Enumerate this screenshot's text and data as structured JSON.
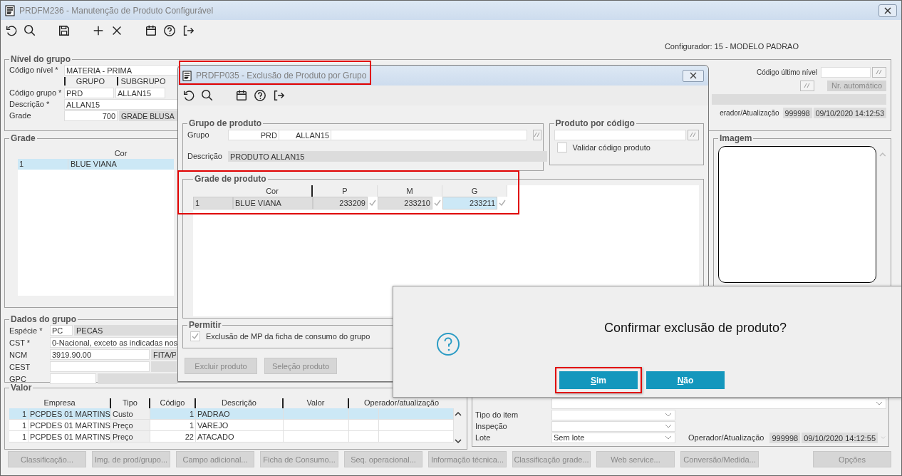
{
  "window": {
    "title": "PRDFM236 - Manutenção de Produto Configurável"
  },
  "configurador": "Configurador: 15 - MODELO PADRAO",
  "nivel_do_grupo": {
    "title": "Nível do grupo",
    "codigo_nivel": {
      "label": "Código nível *",
      "value": "MATERIA - PRIMA"
    },
    "columns": [
      "GRUPO",
      "SUBGRUPO"
    ],
    "codigo_grupo": {
      "label": "Código grupo *",
      "values": [
        "PRD",
        "ALLAN15"
      ]
    },
    "descricao": {
      "label": "Descrição *",
      "value": "ALLAN15"
    },
    "grade": {
      "label": "Grade",
      "value": "700",
      "description": "GRADE BLUSA"
    },
    "codigo_ultimo_nivel": {
      "label": "Código último nível"
    },
    "nr_automatico": "Nr. automático",
    "operador": {
      "label": "erador/Atualização",
      "values": [
        "999998",
        "09/10/2020 14:12:53"
      ]
    }
  },
  "grade": {
    "title": "Grade",
    "columns": [
      "",
      "Cor"
    ],
    "rows": [
      {
        "cells": [
          "1",
          "BLUE VIANA"
        ],
        "selected": true
      }
    ]
  },
  "imagem": {
    "title": "Imagem"
  },
  "dados_do_grupo": {
    "title": "Dados do grupo",
    "especie": {
      "label": "Espécie *",
      "value": "PC",
      "description": "PECAS"
    },
    "cst": {
      "label": "CST *",
      "value": "0-Nacional, exceto as indicadas nos"
    },
    "ncm": {
      "label": "NCM",
      "value": "3919.90.00",
      "description": "FITA/P"
    },
    "cest": {
      "label": "CEST"
    },
    "gpc": {
      "label": "GPC"
    }
  },
  "valor": {
    "title": "Valor",
    "columns": [
      "Empresa",
      "Tipo",
      "Código",
      "Descrição",
      "Valor",
      "Operador/atualização"
    ],
    "rows": [
      {
        "empresa": "1",
        "nome": "PCPDES 01 MARTINS",
        "tipo": "Custo",
        "codigo": "1",
        "descricao": "PADRAO",
        "selected": true
      },
      {
        "empresa": "1",
        "nome": "PCPDES 01 MARTINS",
        "tipo": "Preço",
        "codigo": "1",
        "descricao": "VAREJO",
        "selected": false
      },
      {
        "empresa": "1",
        "nome": "PCPDES 01 MARTINS",
        "tipo": "Preço",
        "codigo": "22",
        "descricao": "ATACADO",
        "selected": false
      }
    ]
  },
  "item_panel": {
    "fields": [
      {
        "kind": "wide"
      },
      {
        "label": "Tipo do item",
        "kind": "narrow"
      },
      {
        "label": "Inspeção",
        "kind": "narrow"
      },
      {
        "label": "Lote",
        "value": "Sem lote",
        "kind": "narrow"
      }
    ],
    "operador": {
      "label": "Operador/Atualização",
      "values": [
        "999998",
        "09/10/2020 14:12:55"
      ]
    }
  },
  "buttons": [
    "Classificação...",
    "Img. de prod/grupo...",
    "Campo adicional...",
    "Ficha de Consumo...",
    "Seq. operacional...",
    "Informação técnica...",
    "Classificação grade...",
    "Web service...",
    "Conversão/Medida..."
  ],
  "options_button": "Opções",
  "dialog": {
    "title": "PRDFP035 - Exclusão de Produto por Grupo",
    "highlighted": true,
    "grupo_de_produto": {
      "title": "Grupo de produto",
      "grupo_label": "Grupo",
      "grupo_values": [
        "PRD",
        "ALLAN15"
      ],
      "descricao_label": "Descrição",
      "descricao": "PRODUTO ALLAN15"
    },
    "produto_por_codigo": {
      "title": "Produto por código",
      "checkbox": {
        "label": "Validar código produto",
        "checked": false
      }
    },
    "grade_de_produto": {
      "title": "Grade de produto",
      "highlighted": true,
      "columns": [
        "",
        "Cor",
        "P",
        "M",
        "G"
      ],
      "rows": [
        {
          "cells": [
            {
              "value": "1"
            },
            {
              "value": "BLUE VIANA"
            },
            {
              "value": "233209",
              "checked": true,
              "selected": false
            },
            {
              "value": "233210",
              "checked": true,
              "selected": false
            },
            {
              "value": "233211",
              "checked": true,
              "selected": true
            }
          ]
        }
      ]
    },
    "permitir": {
      "title": "Permitir",
      "checkbox": {
        "label": "Exclusão de MP da ficha de consumo do grupo",
        "checked": true
      }
    },
    "buttons": [
      "Excluir produto",
      "Seleção produto"
    ]
  },
  "message": {
    "text": "Confirmar exclusão de produto?",
    "buttons": [
      {
        "label": "Sim",
        "highlighted": true
      },
      {
        "label": "Não",
        "highlighted": false
      }
    ]
  }
}
